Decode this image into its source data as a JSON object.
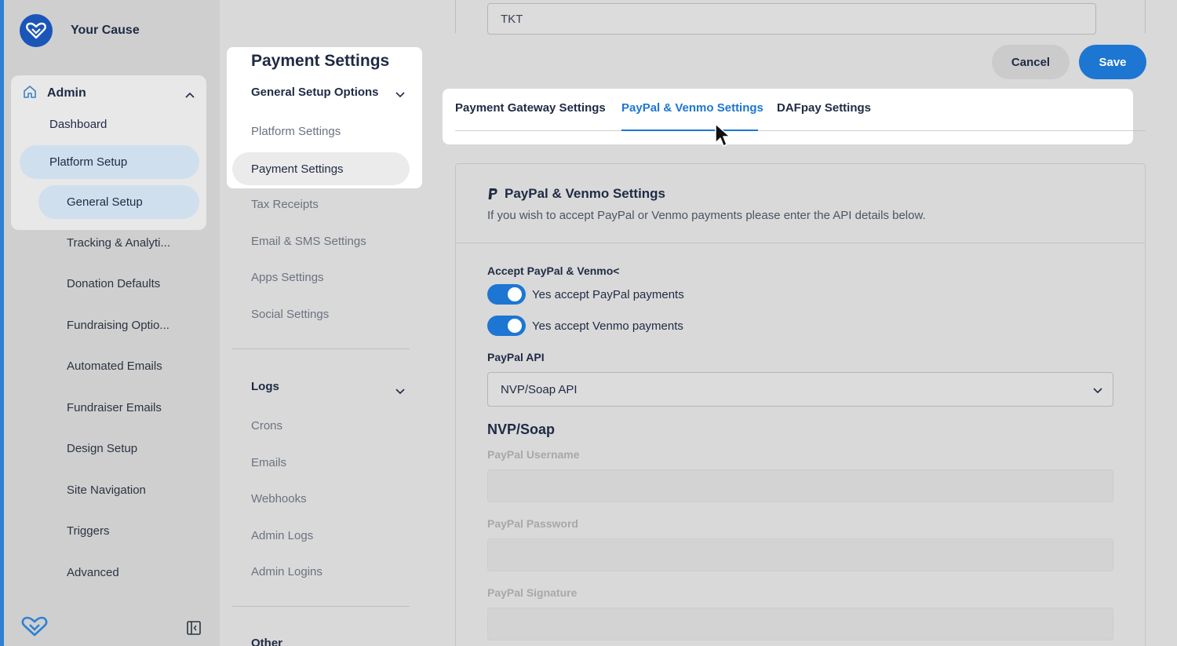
{
  "brand": {
    "name": "Your Cause"
  },
  "sidebar": {
    "admin_label": "Admin",
    "dashboard": "Dashboard",
    "platform_setup": "Platform Setup",
    "general_setup": "General Setup",
    "items": [
      "Tracking & Analyti...",
      "Donation Defaults",
      "Fundraising Optio...",
      "Automated Emails",
      "Fundraiser Emails",
      "Design Setup",
      "Site Navigation",
      "Triggers",
      "Advanced"
    ]
  },
  "middle": {
    "popover_title": "Payment Settings",
    "group_general": "General Setup Options",
    "platform_settings": "Platform Settings",
    "payment_settings": "Payment Settings",
    "tax_receipts": "Tax Receipts",
    "email_sms": "Email & SMS Settings",
    "apps_settings": "Apps Settings",
    "social_settings": "Social Settings",
    "logs_head": "Logs",
    "logs": [
      "Crons",
      "Emails",
      "Webhooks",
      "Admin Logs",
      "Admin Logins"
    ],
    "other_head": "Other"
  },
  "header": {
    "top_input_value": "TKT",
    "cancel_label": "Cancel",
    "save_label": "Save"
  },
  "tabs": [
    {
      "label": "Payment Gateway Settings"
    },
    {
      "label": "PayPal & Venmo Settings"
    },
    {
      "label": "DAFpay Settings"
    }
  ],
  "card": {
    "title": "PayPal & Venmo Settings",
    "subtitle": "If you wish to accept PayPal or Venmo payments please enter the API details below.",
    "accept_label": "Accept PayPal & Venmo<",
    "toggle_paypal": "Yes accept PayPal payments",
    "toggle_venmo": "Yes accept Venmo payments",
    "api_label": "PayPal API",
    "api_value": "NVP/Soap API",
    "section": "NVP/Soap",
    "username_label": "PayPal Username",
    "password_label": "PayPal Password",
    "signature_label": "PayPal Signature"
  },
  "colors": {
    "accent": "#1d76d2",
    "brand": "#1a55b8"
  }
}
